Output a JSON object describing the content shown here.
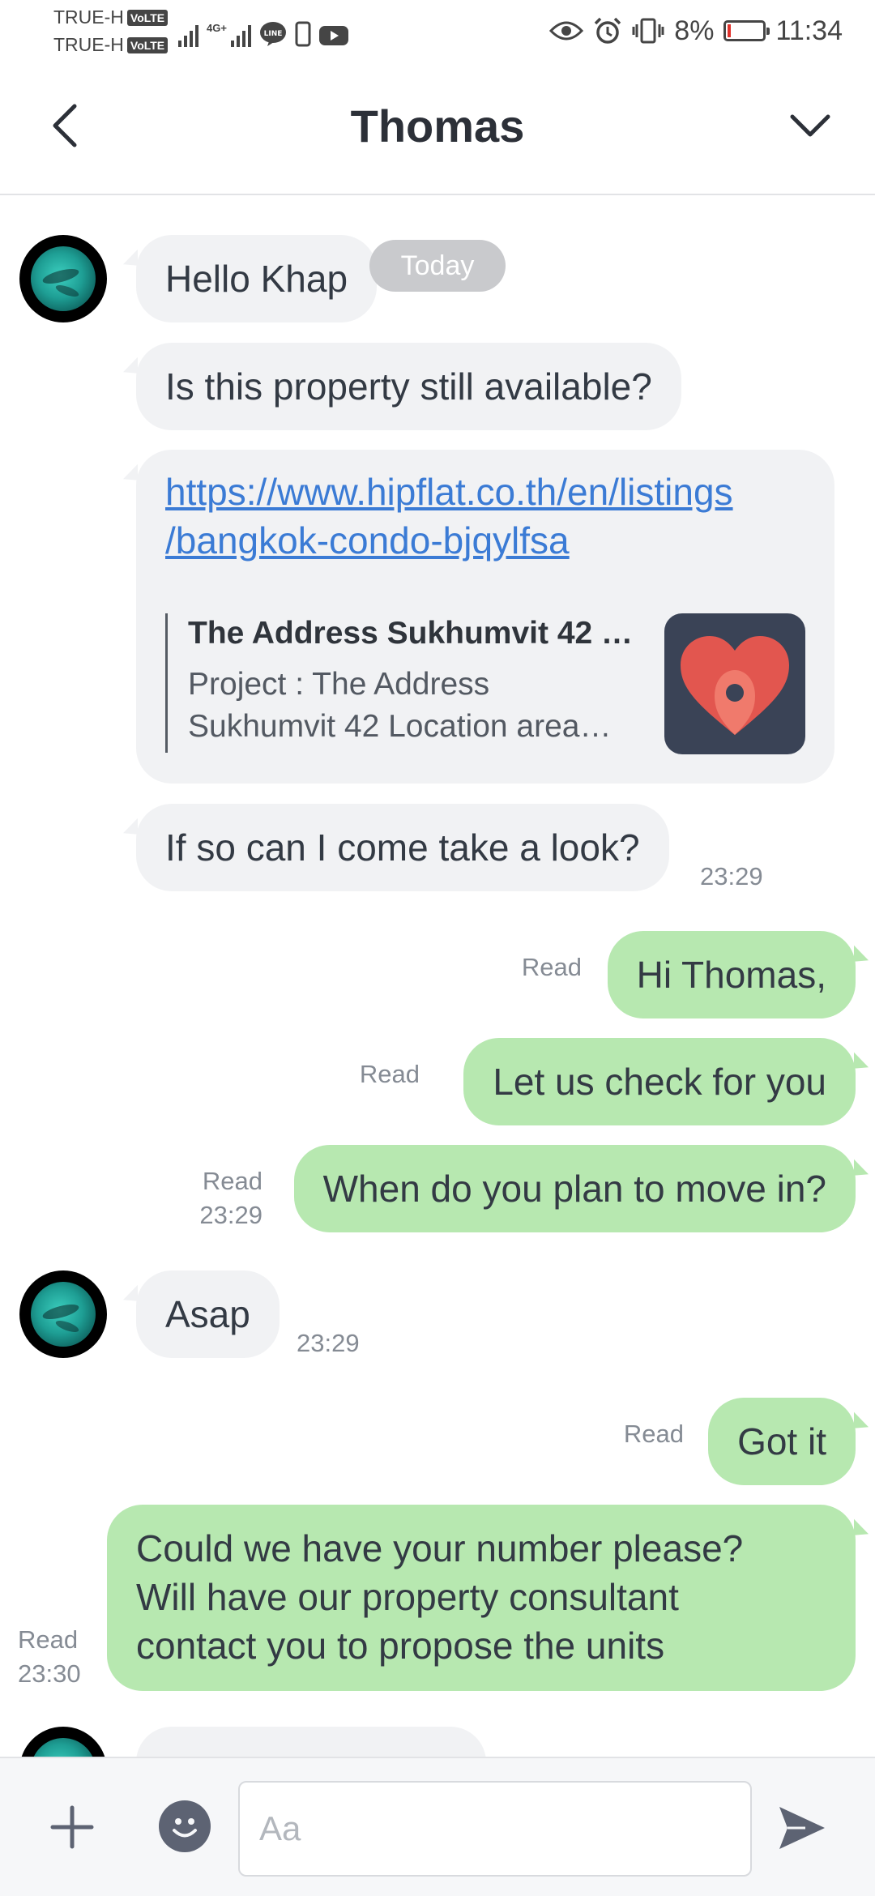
{
  "status_bar": {
    "carrier1": "TRUE-H",
    "carrier2": "TRUE-H",
    "volte": "VoLTE",
    "network": "4G+",
    "battery_pct": "8%",
    "battery_level": 0.08,
    "time": "11:34",
    "icons": [
      "signal-icon",
      "line-app-icon",
      "phone-icon",
      "youtube-icon",
      "eye-icon",
      "alarm-icon",
      "vibrate-icon",
      "battery-icon"
    ]
  },
  "header": {
    "title": "Thomas",
    "back_icon": "chevron-left-icon",
    "menu_icon": "chevron-down-icon"
  },
  "day_chip": "Today",
  "messages": {
    "m1": {
      "text": "Hello Khap"
    },
    "m2": {
      "text": "Is this property still available?"
    },
    "m3": {
      "link": "https://www.hipflat.co.th/en/listings/bangkok-condo-bjqylfsa",
      "link_line1": "https://www.hipflat.co.th/en/listings",
      "link_line2": "/bangkok-condo-bjqylfsa",
      "preview_title": "The Address Sukhumvit 42 …",
      "preview_desc_line1": "Project : The Address",
      "preview_desc_line2": "Sukhumvit 42 Location area…"
    },
    "m4": {
      "text": "If so can I come take a look?",
      "time": "23:29"
    },
    "m5": {
      "text": "Hi Thomas,",
      "status": "Read"
    },
    "m6": {
      "text": "Let us check for you",
      "status": "Read"
    },
    "m7": {
      "text": "When do you plan to move in?",
      "status": "Read",
      "time": "23:29"
    },
    "m8": {
      "text": "Asap",
      "time": "23:29"
    },
    "m9": {
      "text": "Got it",
      "status": "Read"
    },
    "m10": {
      "line1": "Could we have your number please?",
      "line2": "Will have our property consultant",
      "line3": "contact you to propose the units",
      "status": "Read",
      "time": "23:30"
    }
  },
  "input_bar": {
    "placeholder": "Aa",
    "value": "",
    "plus_icon": "plus-icon",
    "emoji_icon": "emoji-icon",
    "send_icon": "send-icon"
  },
  "colors": {
    "incoming_bubble": "#f1f2f4",
    "outgoing_bubble": "#b7e8b0",
    "link": "#3b7bd5",
    "meta_text": "#858b94"
  }
}
